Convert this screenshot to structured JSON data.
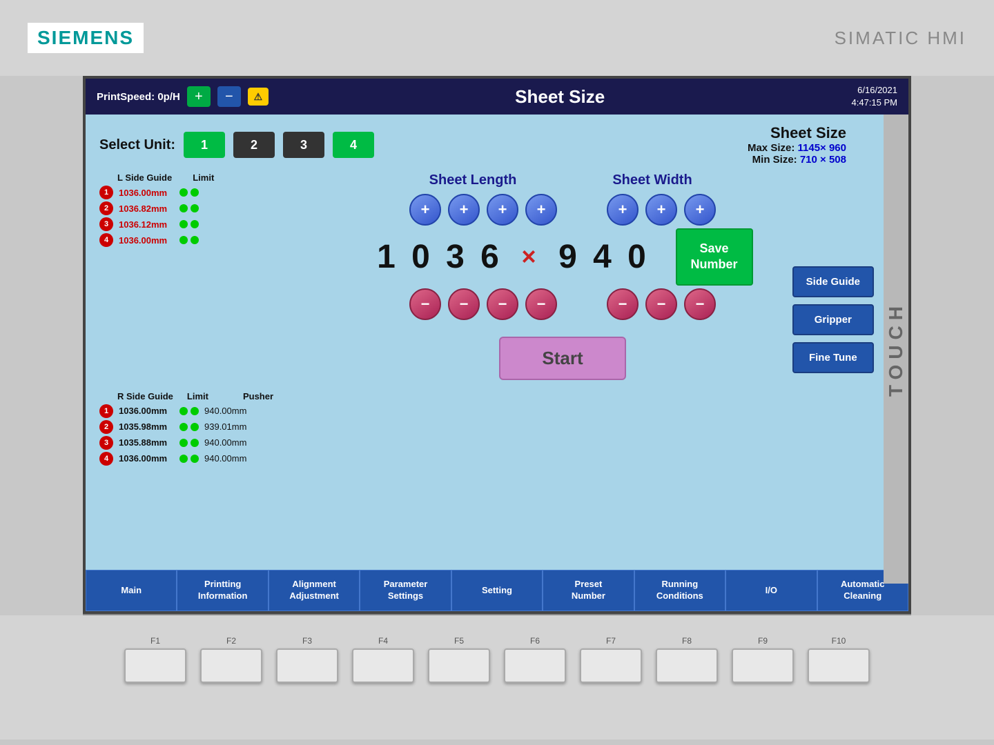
{
  "device": {
    "brand": "SIEMENS",
    "product": "SIMATIC HMI",
    "touch_label": "TOUCH"
  },
  "header": {
    "print_speed_label": "PrintSpeed: 0p/H",
    "plus_label": "+",
    "minus_label": "−",
    "warn_label": "⚠",
    "title": "Sheet Size",
    "date": "6/16/2021",
    "time": "4:47:15 PM"
  },
  "sheet_size_info": {
    "title": "Sheet  Size",
    "max_label": "Max Size:",
    "max_value": "1145× 960",
    "min_label": "Min Size:",
    "min_value": "710  × 508"
  },
  "select_unit": {
    "label": "Select Unit:",
    "units": [
      {
        "id": 1,
        "active": true
      },
      {
        "id": 2,
        "active": false
      },
      {
        "id": 3,
        "active": false
      },
      {
        "id": 4,
        "active": true
      }
    ]
  },
  "sheet_length": {
    "title": "Sheet Length",
    "digits": [
      "1",
      "0",
      "3",
      "6"
    ],
    "plus": "+",
    "minus": "−"
  },
  "sheet_width": {
    "title": "Sheet Width",
    "digits": [
      "9",
      "4",
      "0"
    ],
    "plus": "+",
    "minus": "−"
  },
  "multiply_sign": "×",
  "save_number_btn": "Save\nNumber",
  "start_btn": "Start",
  "l_side_guide": {
    "header_col1": "L Side Guide",
    "header_col2": "Limit",
    "rows": [
      {
        "num": 1,
        "value": "1036.00mm",
        "dots": 2
      },
      {
        "num": 2,
        "value": "1036.82mm",
        "dots": 2
      },
      {
        "num": 3,
        "value": "1036.12mm",
        "dots": 2
      },
      {
        "num": 4,
        "value": "1036.00mm",
        "dots": 2
      }
    ]
  },
  "r_side_guide": {
    "header_col1": "R Side Guide",
    "header_col2": "Limit",
    "header_col3": "Pusher",
    "rows": [
      {
        "num": 1,
        "value": "1036.00mm",
        "dots": 2,
        "pusher": "940.00mm"
      },
      {
        "num": 2,
        "value": "1035.98mm",
        "dots": 2,
        "pusher": "939.01mm"
      },
      {
        "num": 3,
        "value": "1035.88mm",
        "dots": 2,
        "pusher": "940.00mm"
      },
      {
        "num": 4,
        "value": "1036.00mm",
        "dots": 2,
        "pusher": "940.00mm"
      }
    ]
  },
  "right_buttons": [
    {
      "label": "Side Guide"
    },
    {
      "label": "Gripper"
    },
    {
      "label": "Fine Tune"
    }
  ],
  "nav_buttons": [
    {
      "label": "Main"
    },
    {
      "label": "Printting\nInformation"
    },
    {
      "label": "Alignment\nAdjustment"
    },
    {
      "label": "Parameter\nSettings"
    },
    {
      "label": "Setting"
    },
    {
      "label": "Preset\nNumber"
    },
    {
      "label": "Running\nConditions"
    },
    {
      "label": "I/O"
    },
    {
      "label": "Automatic\nCleaning"
    }
  ],
  "fn_keys": [
    "F1",
    "F2",
    "F3",
    "F4",
    "F5",
    "F6",
    "F7",
    "F8",
    "F9",
    "F10"
  ]
}
